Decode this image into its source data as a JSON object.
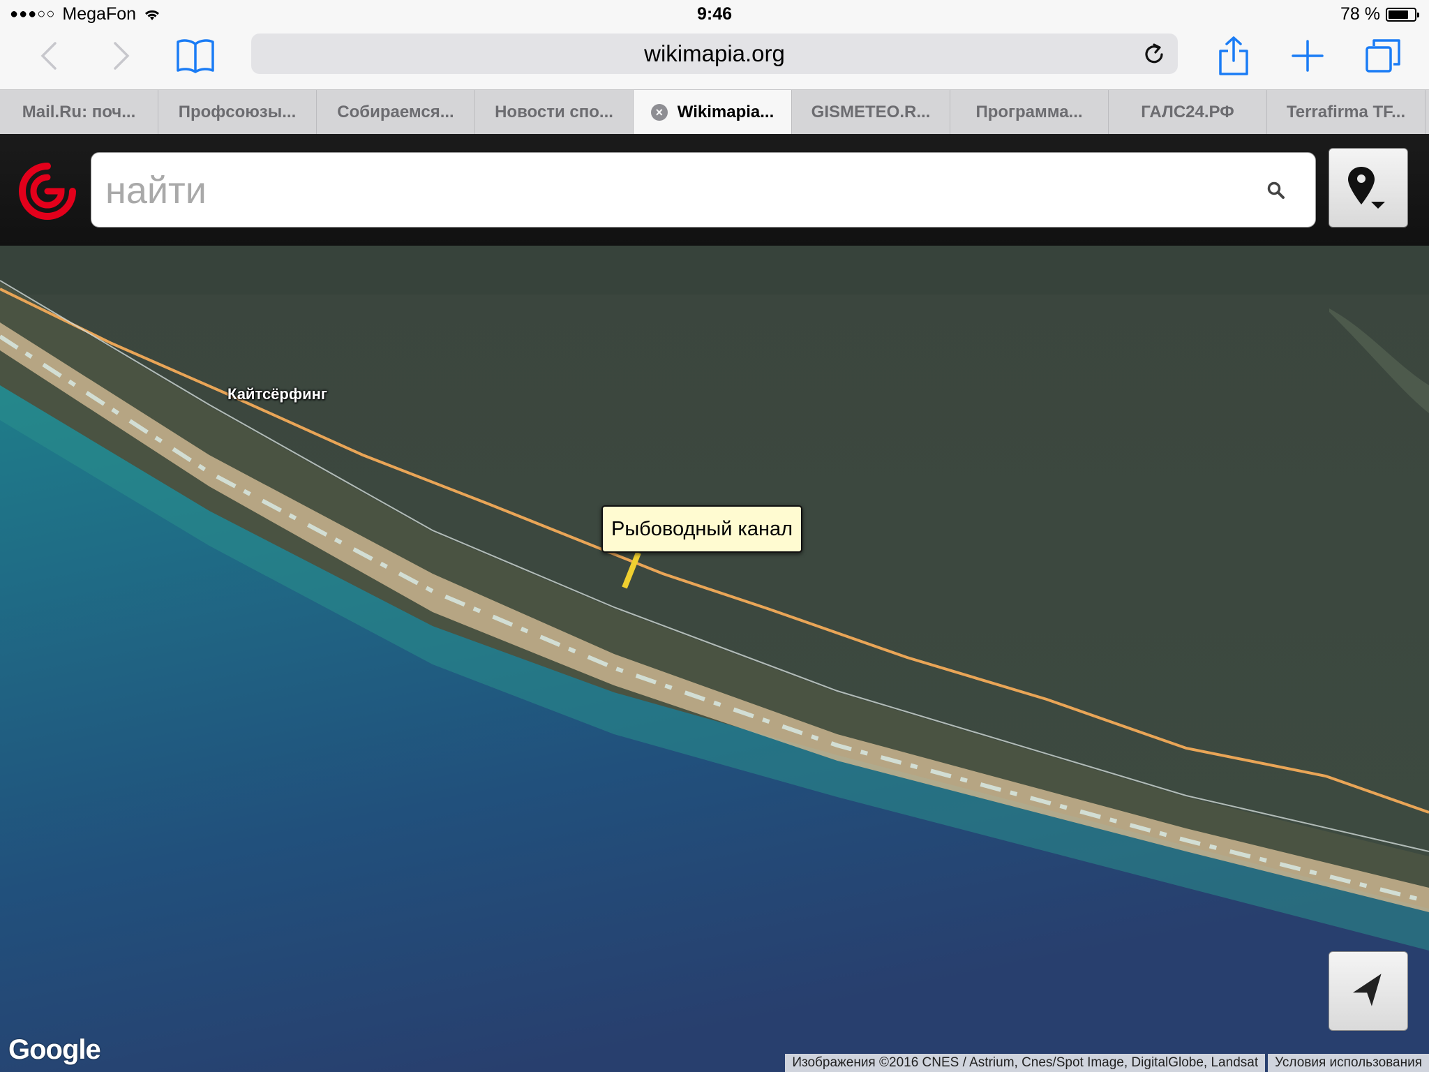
{
  "status_bar": {
    "signal": "●●●○○",
    "carrier": "MegaFon",
    "time": "9:46",
    "battery_text": "78 %",
    "battery_level": 0.78
  },
  "browser": {
    "url": "wikimapia.org",
    "icons": [
      "back-icon",
      "forward-icon",
      "bookmarks-icon",
      "reload-icon",
      "share-icon",
      "new-tab-icon",
      "tabs-icon"
    ]
  },
  "tabs": [
    {
      "label": "Mail.Ru: поч...",
      "active": false
    },
    {
      "label": "Профсоюзы...",
      "active": false
    },
    {
      "label": "Собираемся...",
      "active": false
    },
    {
      "label": "Новости спо...",
      "active": false
    },
    {
      "label": "Wikimapia...",
      "active": true
    },
    {
      "label": "GISMETEO.R...",
      "active": false
    },
    {
      "label": "Программа...",
      "active": false
    },
    {
      "label": "ГАЛС24.РФ",
      "active": false
    },
    {
      "label": "Terrafirma TF...",
      "active": false
    }
  ],
  "search": {
    "placeholder": "найти"
  },
  "map": {
    "label_kite": "Кайтсёрфинг",
    "tooltip": "Рыбоводный канал",
    "google_logo": "Google",
    "attribution": "Изображения ©2016 CNES / Astrium, Cnes/Spot Image, DigitalGlobe, Landsat",
    "terms": "Условия использования"
  },
  "colors": {
    "sea_deep": "#1f4f7c",
    "sea_shallow": "#1f8a8c",
    "lagoon": "#3b4a40",
    "beach": "#c9b48e",
    "road": "#e9a557",
    "brand_red": "#e3001b"
  }
}
